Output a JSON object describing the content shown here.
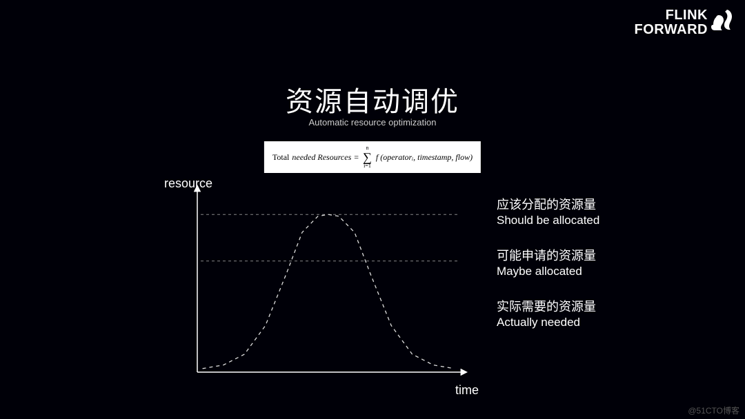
{
  "logo": {
    "line1": "FLINK",
    "line2": "FORWARD"
  },
  "title": "资源自动调优",
  "subtitle": "Automatic resource optimization",
  "formula": {
    "lhs_prefix": "Total ",
    "lhs_italic": "needed Resources",
    "eq": " = ",
    "sum_top": "n",
    "sum_bottom": "i=1",
    "rhs": "f (operatorᵢ, timestamp, flow)"
  },
  "axes": {
    "y": "resource",
    "x": "time"
  },
  "legend": [
    {
      "zh": "应该分配的资源量",
      "en": "Should be allocated"
    },
    {
      "zh": "可能申请的资源量",
      "en": "Maybe allocated"
    },
    {
      "zh": "实际需要的资源量",
      "en": "Actually needed"
    }
  ],
  "chart_data": {
    "type": "line",
    "title": "Automatic resource optimization",
    "xlabel": "time",
    "ylabel": "resource",
    "series": [
      {
        "name": "Should be allocated",
        "style": "horizontal-dashed",
        "y": 0.88
      },
      {
        "name": "Maybe allocated",
        "style": "horizontal-dashed",
        "y": 0.62
      },
      {
        "name": "Actually needed",
        "style": "bell-dashed",
        "x": [
          0.02,
          0.1,
          0.18,
          0.26,
          0.34,
          0.4,
          0.46,
          0.5,
          0.54,
          0.6,
          0.66,
          0.74,
          0.82,
          0.9,
          0.98
        ],
        "values": [
          0.02,
          0.04,
          0.1,
          0.26,
          0.55,
          0.78,
          0.87,
          0.88,
          0.87,
          0.78,
          0.55,
          0.26,
          0.1,
          0.04,
          0.02
        ]
      }
    ],
    "xlim": [
      0,
      1
    ],
    "ylim": [
      0,
      1
    ]
  },
  "watermark": "@51CTO博客"
}
